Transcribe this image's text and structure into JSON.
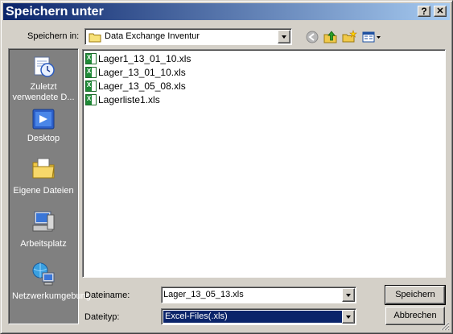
{
  "window": {
    "title": "Speichern unter",
    "help_button": "?",
    "close_button": "✕"
  },
  "top_bar": {
    "save_in_label": "Speichern in:",
    "location_value": "Data Exchange Inventur"
  },
  "places": [
    {
      "label": "Zuletzt verwendete D...",
      "icon": "recent-documents-icon"
    },
    {
      "label": "Desktop",
      "icon": "desktop-icon"
    },
    {
      "label": "Eigene Dateien",
      "icon": "my-documents-icon"
    },
    {
      "label": "Arbeitsplatz",
      "icon": "my-computer-icon"
    },
    {
      "label": "Netzwerkumgebung",
      "icon": "network-icon"
    }
  ],
  "files": [
    "Lager1_13_01_10.xls",
    "Lager_13_01_10.xls",
    "Lager_13_05_08.xls",
    "Lagerliste1.xls"
  ],
  "form": {
    "filename_label": "Dateiname:",
    "filename_value": "Lager_13_05_13.xls",
    "filetype_label": "Dateityp:",
    "filetype_value": "Excel-Files(.xls)"
  },
  "buttons": {
    "save": "Speichern",
    "cancel": "Abbrechen"
  }
}
